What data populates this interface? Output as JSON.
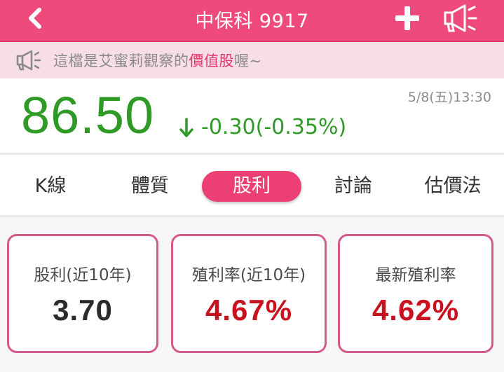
{
  "header": {
    "title": "中保科 9917"
  },
  "notice": {
    "prefix": "這檔是艾蜜莉觀察的",
    "highlight": "價值股",
    "suffix": "喔~"
  },
  "quote": {
    "price": "86.50",
    "change": "-0.30(-0.35%)",
    "direction": "down",
    "timestamp": "5/8(五)13:30",
    "color": "#2f9a26"
  },
  "tabs": [
    {
      "label": "K線",
      "active": false
    },
    {
      "label": "體質",
      "active": false
    },
    {
      "label": "股利",
      "active": true
    },
    {
      "label": "討論",
      "active": false
    },
    {
      "label": "估價法",
      "active": false
    }
  ],
  "cards": [
    {
      "label": "股利(近10年)",
      "value": "3.70",
      "value_color": "#2b2b2b"
    },
    {
      "label": "殖利率(近10年)",
      "value": "4.67%",
      "value_color": "#c8121f"
    },
    {
      "label": "最新殖利率",
      "value": "4.62%",
      "value_color": "#c8121f"
    }
  ],
  "theme": {
    "accent": "#ee4a7c",
    "notice_bg": "#f7dde5",
    "card_border": "#d35a8a"
  },
  "icons": {
    "back": "chevron-left-icon",
    "add": "plus-icon",
    "announce": "megaphone-icon",
    "notice": "megaphone-icon",
    "change": "arrow-down-icon"
  }
}
